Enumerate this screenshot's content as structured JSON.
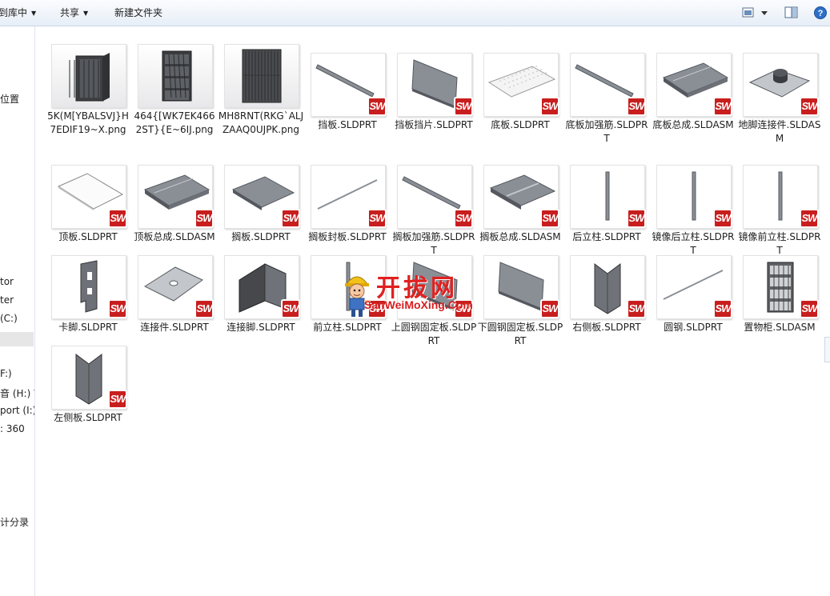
{
  "toolbar": {
    "library_label": "到库中",
    "share_label": "共享",
    "new_folder_label": "新建文件夹"
  },
  "nav": {
    "items": [
      "位置",
      "tor",
      "ter",
      "(C:)",
      "F:)",
      "音 (H:) W",
      "port (I:)",
      ": 360",
      "计分录"
    ]
  },
  "files": [
    {
      "name": "5K(M[YBALSVJ}H7EDIF19~X.png",
      "kind": "png",
      "icon": "cabinet-photo-icon"
    },
    {
      "name": "464{[WK7EK4662ST}{E~6IJ.png",
      "kind": "png",
      "icon": "cabinet-open-photo-icon"
    },
    {
      "name": "MH8RNT(RKG`ALJZAAQ0UJPK.png",
      "kind": "png",
      "icon": "cabinet-front-photo-icon"
    },
    {
      "name": "挡板.SLDPRT",
      "kind": "sw",
      "icon": "rod-icon"
    },
    {
      "name": "挡板挡片.SLDPRT",
      "kind": "sw",
      "icon": "panel-icon"
    },
    {
      "name": "底板.SLDPRT",
      "kind": "sw",
      "icon": "perforated-plate-icon"
    },
    {
      "name": "底板加强筋.SLDPRT",
      "kind": "sw",
      "icon": "rod-icon"
    },
    {
      "name": "底板总成.SLDASM",
      "kind": "sw",
      "icon": "plate-assembly-icon"
    },
    {
      "name": "地脚连接件.SLDASM",
      "kind": "sw",
      "icon": "foot-connector-icon"
    },
    {
      "name": "顶板.SLDPRT",
      "kind": "sw",
      "icon": "flat-plate-icon"
    },
    {
      "name": "顶板总成.SLDASM",
      "kind": "sw",
      "icon": "plate-assembly-icon"
    },
    {
      "name": "搁板.SLDPRT",
      "kind": "sw",
      "icon": "shelf-plate-icon"
    },
    {
      "name": "搁板封板.SLDPRT",
      "kind": "sw",
      "icon": "thin-rod-icon"
    },
    {
      "name": "搁板加强筋.SLDPRT",
      "kind": "sw",
      "icon": "rod-icon"
    },
    {
      "name": "搁板总成.SLDASM",
      "kind": "sw",
      "icon": "shelf-assembly-icon"
    },
    {
      "name": "后立柱.SLDPRT",
      "kind": "sw",
      "icon": "vertical-post-icon"
    },
    {
      "name": "镜像后立柱.SLDPRT",
      "kind": "sw",
      "icon": "vertical-post-icon"
    },
    {
      "name": "镜像前立柱.SLDPRT",
      "kind": "sw",
      "icon": "vertical-post-icon"
    },
    {
      "name": "卡脚.SLDPRT",
      "kind": "sw",
      "icon": "clip-foot-icon"
    },
    {
      "name": "连接件.SLDPRT",
      "kind": "sw",
      "icon": "connector-plate-icon"
    },
    {
      "name": "连接脚.SLDPRT",
      "kind": "sw",
      "icon": "angle-bracket-icon"
    },
    {
      "name": "前立柱.SLDPRT",
      "kind": "sw",
      "icon": "vertical-post-icon"
    },
    {
      "name": "上圆钢固定板.SLDPRT",
      "kind": "sw",
      "icon": "panel-icon"
    },
    {
      "name": "下圆钢固定板.SLDPRT",
      "kind": "sw",
      "icon": "panel-icon"
    },
    {
      "name": "右侧板.SLDPRT",
      "kind": "sw",
      "icon": "side-panel-icon"
    },
    {
      "name": "圆钢.SLDPRT",
      "kind": "sw",
      "icon": "thin-rod-icon"
    },
    {
      "name": "置物柜.SLDASM",
      "kind": "sw",
      "icon": "cabinet-assembly-icon"
    },
    {
      "name": "左侧板.SLDPRT",
      "kind": "sw",
      "icon": "side-panel-icon"
    }
  ],
  "badge": {
    "text": "SW",
    "color": "#c81e1e"
  },
  "watermark": {
    "title": "开拔网",
    "url": "SanWeiMoXing.Com"
  }
}
